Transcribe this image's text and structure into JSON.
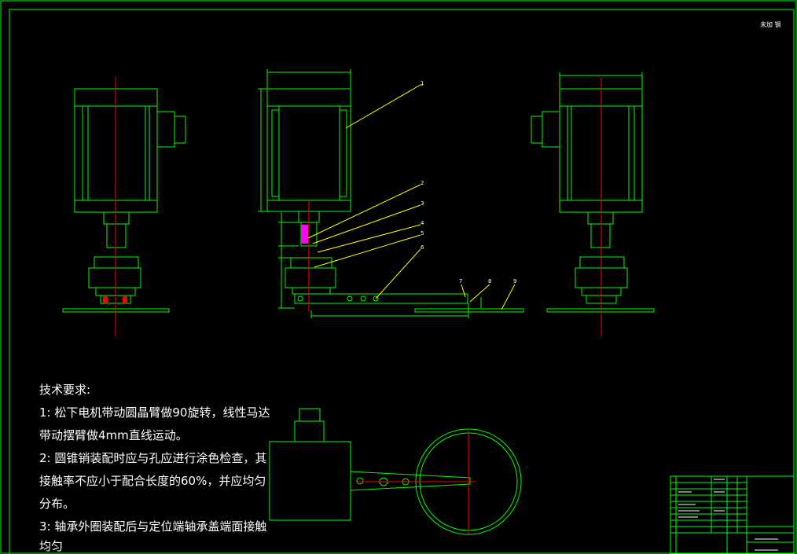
{
  "corner_mark": "未加 钢",
  "tech_requirements": {
    "title": "技术要求:",
    "lines": [
      "1: 松下电机带动圆晶臂做90旋转，线性马达",
      "带动摆臂做4mm直线运动。",
      "2: 圆锥销装配时应与孔应进行涂色检查，其",
      "接触率不应小于配合长度的60%，并应均匀",
      "分布。",
      "3: 轴承外圈装配后与定位端轴承盖端面接触",
      "均匀"
    ]
  },
  "part_labels": [
    "1",
    "2",
    "3",
    "4",
    "5",
    "6",
    "7",
    "8",
    "9"
  ],
  "colors": {
    "background": "#000000",
    "frame": "#00ff00",
    "part_outline": "#00ff00",
    "center_line": "#ff0000",
    "leader": "#ffff00",
    "text": "#ffffff",
    "hatch": "#ff00ff"
  }
}
